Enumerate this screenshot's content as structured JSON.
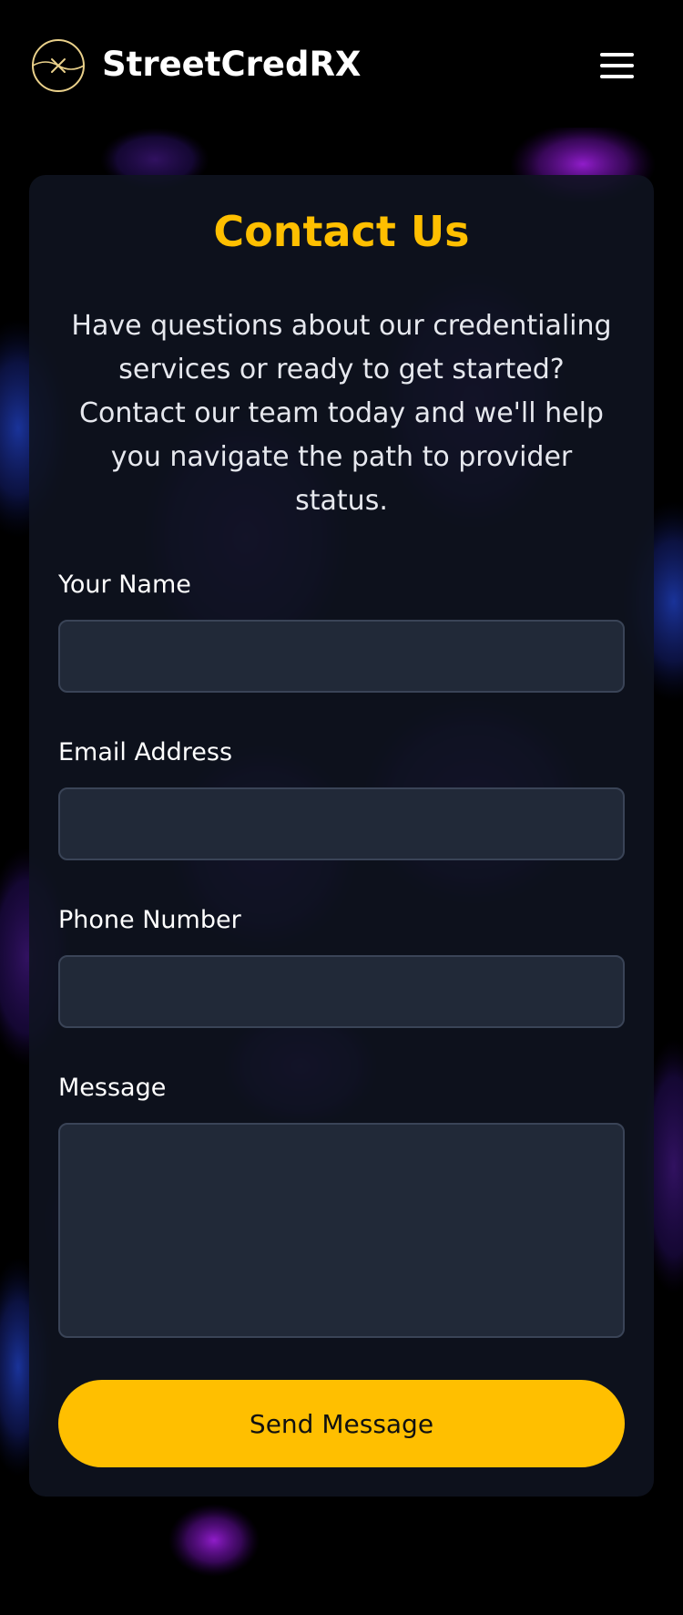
{
  "header": {
    "brand": "StreetCredRX",
    "logo_icon": "circle-x-logo-icon",
    "menu_icon": "hamburger-menu-icon"
  },
  "contact": {
    "title": "Contact Us",
    "intro": "Have questions about our credentialing services or ready to get started? Contact our team today and we'll help you navigate the path to provider status.",
    "fields": {
      "name": {
        "label": "Your Name",
        "value": ""
      },
      "email": {
        "label": "Email Address",
        "value": ""
      },
      "phone": {
        "label": "Phone Number",
        "value": ""
      },
      "message": {
        "label": "Message",
        "value": ""
      }
    },
    "submit_label": "Send Message"
  },
  "colors": {
    "page_background": "#000000",
    "accent": "#ffbf00",
    "card_background": "#0f1320",
    "input_background": "#212938",
    "input_border": "#3a4457"
  }
}
